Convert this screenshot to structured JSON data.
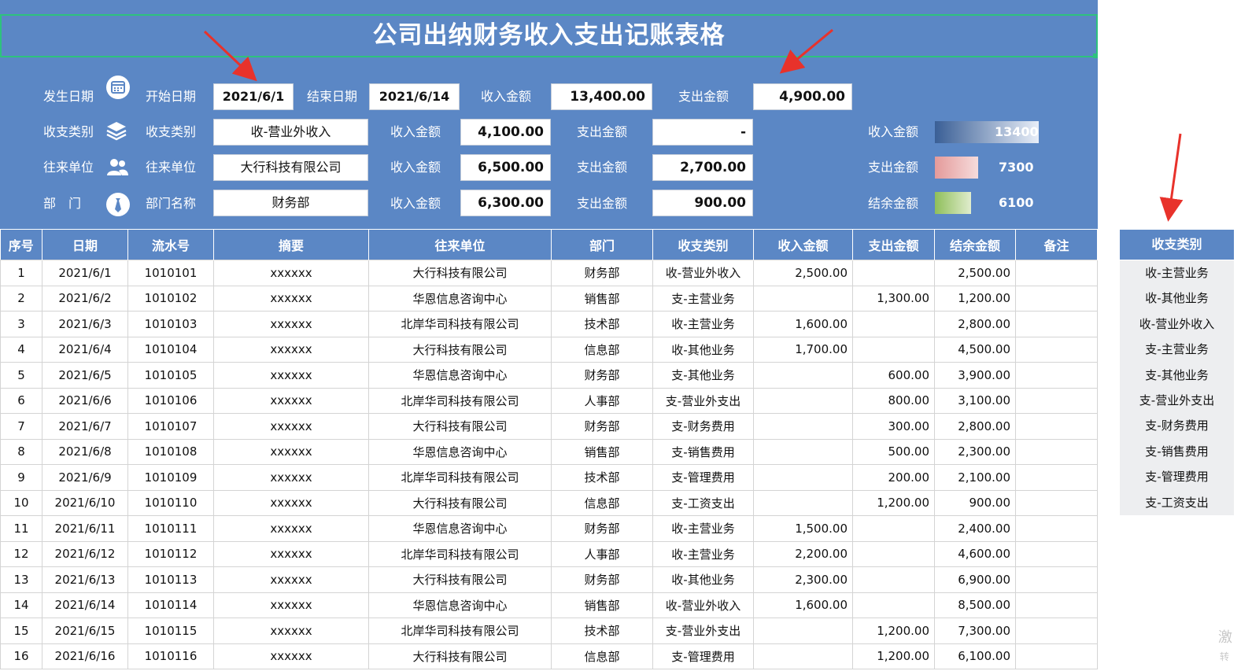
{
  "title": "公司出纳财务收入支出记账表格",
  "filters": {
    "row1": {
      "icon_label": "发生日期",
      "start_label": "开始日期",
      "start_value": "2021/6/1",
      "end_label": "结束日期",
      "end_value": "2021/6/14",
      "income_label": "收入金额",
      "income_value": "13,400.00",
      "expense_label": "支出金额",
      "expense_value": "4,900.00"
    },
    "row2": {
      "icon_label": "收支类别",
      "field_label": "收支类别",
      "field_value": "收-营业外收入",
      "income_label": "收入金额",
      "income_value": "4,100.00",
      "expense_label": "支出金额",
      "expense_value": "-"
    },
    "row3": {
      "icon_label": "往来单位",
      "field_label": "往来单位",
      "field_value": "大行科技有限公司",
      "income_label": "收入金额",
      "income_value": "6,500.00",
      "expense_label": "支出金额",
      "expense_value": "2,700.00"
    },
    "row4": {
      "icon_label": "部　门",
      "field_label": "部门名称",
      "field_value": "财务部",
      "income_label": "收入金额",
      "income_value": "6,300.00",
      "expense_label": "支出金额",
      "expense_value": "900.00"
    }
  },
  "summary": {
    "items": [
      {
        "label": "收入金额",
        "value": "13400",
        "fraction": 1.0,
        "color_from": "#3a5f96",
        "color_to": "#e8eef8"
      },
      {
        "label": "支出金额",
        "value": "7300",
        "fraction": 0.42,
        "color_from": "#e49a9a",
        "color_to": "#f6dcdc"
      },
      {
        "label": "结余金额",
        "value": "6100",
        "fraction": 0.35,
        "color_from": "#8fbf5a",
        "color_to": "#e0eccd"
      }
    ]
  },
  "table": {
    "headers": [
      "序号",
      "日期",
      "流水号",
      "摘要",
      "往来单位",
      "部门",
      "收支类别",
      "收入金额",
      "支出金额",
      "结余金额",
      "备注"
    ],
    "rows": [
      [
        "1",
        "2021/6/1",
        "1010101",
        "xxxxxx",
        "大行科技有限公司",
        "财务部",
        "收-营业外收入",
        "2,500.00",
        "",
        "2,500.00",
        ""
      ],
      [
        "2",
        "2021/6/2",
        "1010102",
        "xxxxxx",
        "华恩信息咨询中心",
        "销售部",
        "支-主营业务",
        "",
        "1,300.00",
        "1,200.00",
        ""
      ],
      [
        "3",
        "2021/6/3",
        "1010103",
        "xxxxxx",
        "北岸华司科技有限公司",
        "技术部",
        "收-主营业务",
        "1,600.00",
        "",
        "2,800.00",
        ""
      ],
      [
        "4",
        "2021/6/4",
        "1010104",
        "xxxxxx",
        "大行科技有限公司",
        "信息部",
        "收-其他业务",
        "1,700.00",
        "",
        "4,500.00",
        ""
      ],
      [
        "5",
        "2021/6/5",
        "1010105",
        "xxxxxx",
        "华恩信息咨询中心",
        "财务部",
        "支-其他业务",
        "",
        "600.00",
        "3,900.00",
        ""
      ],
      [
        "6",
        "2021/6/6",
        "1010106",
        "xxxxxx",
        "北岸华司科技有限公司",
        "人事部",
        "支-营业外支出",
        "",
        "800.00",
        "3,100.00",
        ""
      ],
      [
        "7",
        "2021/6/7",
        "1010107",
        "xxxxxx",
        "大行科技有限公司",
        "财务部",
        "支-财务费用",
        "",
        "300.00",
        "2,800.00",
        ""
      ],
      [
        "8",
        "2021/6/8",
        "1010108",
        "xxxxxx",
        "华恩信息咨询中心",
        "销售部",
        "支-销售费用",
        "",
        "500.00",
        "2,300.00",
        ""
      ],
      [
        "9",
        "2021/6/9",
        "1010109",
        "xxxxxx",
        "北岸华司科技有限公司",
        "技术部",
        "支-管理费用",
        "",
        "200.00",
        "2,100.00",
        ""
      ],
      [
        "10",
        "2021/6/10",
        "1010110",
        "xxxxxx",
        "大行科技有限公司",
        "信息部",
        "支-工资支出",
        "",
        "1,200.00",
        "900.00",
        ""
      ],
      [
        "11",
        "2021/6/11",
        "1010111",
        "xxxxxx",
        "华恩信息咨询中心",
        "财务部",
        "收-主营业务",
        "1,500.00",
        "",
        "2,400.00",
        ""
      ],
      [
        "12",
        "2021/6/12",
        "1010112",
        "xxxxxx",
        "北岸华司科技有限公司",
        "人事部",
        "收-主营业务",
        "2,200.00",
        "",
        "4,600.00",
        ""
      ],
      [
        "13",
        "2021/6/13",
        "1010113",
        "xxxxxx",
        "大行科技有限公司",
        "财务部",
        "收-其他业务",
        "2,300.00",
        "",
        "6,900.00",
        ""
      ],
      [
        "14",
        "2021/6/14",
        "1010114",
        "xxxxxx",
        "华恩信息咨询中心",
        "销售部",
        "收-营业外收入",
        "1,600.00",
        "",
        "8,500.00",
        ""
      ],
      [
        "15",
        "2021/6/15",
        "1010115",
        "xxxxxx",
        "北岸华司科技有限公司",
        "技术部",
        "支-营业外支出",
        "",
        "1,200.00",
        "7,300.00",
        ""
      ],
      [
        "16",
        "2021/6/16",
        "1010116",
        "xxxxxx",
        "大行科技有限公司",
        "信息部",
        "支-管理费用",
        "",
        "1,200.00",
        "6,100.00",
        ""
      ]
    ]
  },
  "category_list": {
    "header": "收支类别",
    "items": [
      "收-主营业务",
      "收-其他业务",
      "收-营业外收入",
      "支-主营业务",
      "支-其他业务",
      "支-营业外支出",
      "支-财务费用",
      "支-销售费用",
      "支-管理费用",
      "支-工资支出"
    ]
  },
  "watermark": {
    "line1": "激",
    "line2": "转"
  },
  "colors": {
    "panel": "#5b87c5",
    "title_border": "#2ec27e",
    "arrow": "#e8322b"
  }
}
